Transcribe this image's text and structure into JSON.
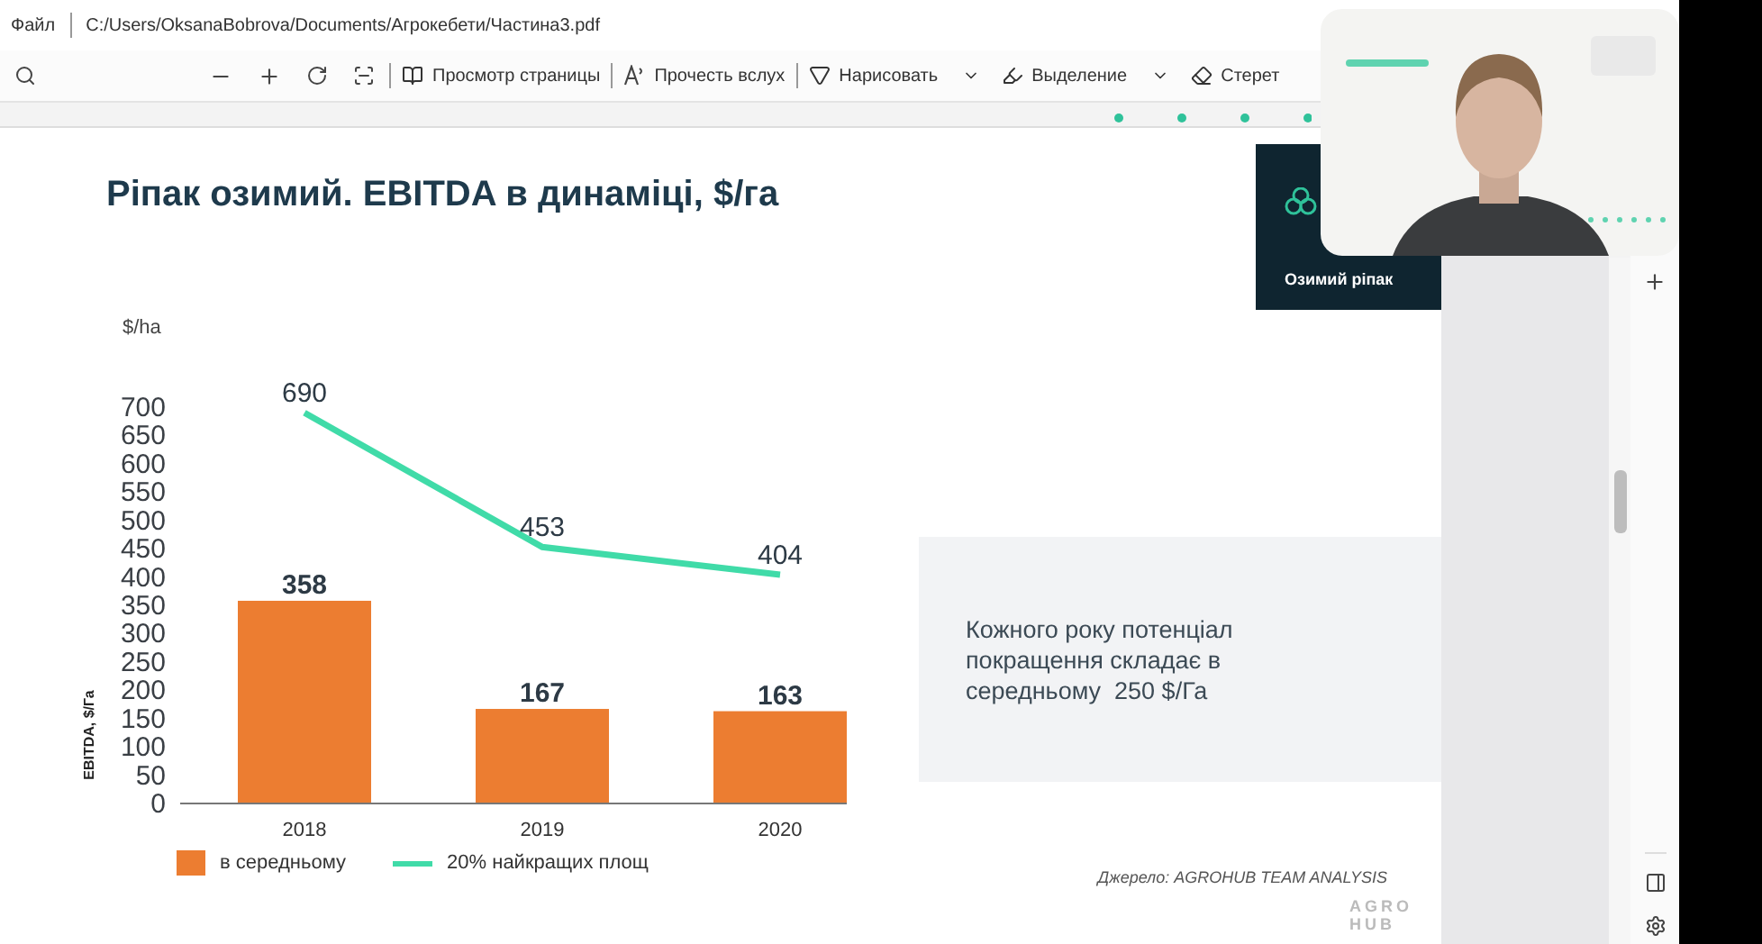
{
  "title_bar": {
    "menu": "Файл",
    "path": "C:/Users/OksanaBobrova/Documents/Агрокебети/Частина3.pdf"
  },
  "toolbar": {
    "items": [
      {
        "label": "Просмотр страницы",
        "dropdown": false
      },
      {
        "label": "Прочесть вслух",
        "dropdown": false
      },
      {
        "label": "Нарисовать",
        "dropdown": true
      },
      {
        "label": "Выделение",
        "dropdown": true
      },
      {
        "label": "Стерет",
        "dropdown": false
      }
    ]
  },
  "slide": {
    "title": "Ріпак озимий. EBITDA в динаміці, $/га",
    "tile_label": "Озимий ріпак",
    "unit": "$/ha",
    "chart_data": {
      "type": "bar",
      "ylabel": "EBITDA, $/Га",
      "categories": [
        "2018",
        "2019",
        "2020"
      ],
      "ylim": [
        0,
        700
      ],
      "yticks": [
        0,
        50,
        100,
        150,
        200,
        250,
        300,
        350,
        400,
        450,
        500,
        550,
        600,
        650,
        700
      ],
      "data_labels": true,
      "series": [
        {
          "name": "в середньому",
          "type": "bar",
          "color": "#ec7d31",
          "values": [
            358,
            167,
            163
          ]
        },
        {
          "name": "20% найкращих площ",
          "type": "line",
          "color": "#40dba8",
          "values": [
            690,
            453,
            404
          ]
        }
      ]
    },
    "note": "Кожного року потенціал покращення складає в середньому  250 $/Га",
    "source": "Джерело: AGROHUB TEAM ANALYSIS",
    "logo": [
      "AGRO",
      "HUB"
    ]
  }
}
